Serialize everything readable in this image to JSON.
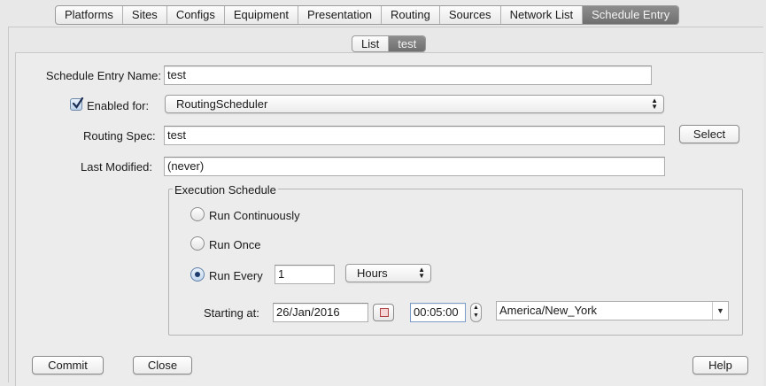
{
  "tabs": [
    {
      "label": "Platforms",
      "active": false
    },
    {
      "label": "Sites",
      "active": false
    },
    {
      "label": "Configs",
      "active": false
    },
    {
      "label": "Equipment",
      "active": false
    },
    {
      "label": "Presentation",
      "active": false
    },
    {
      "label": "Routing",
      "active": false
    },
    {
      "label": "Sources",
      "active": false
    },
    {
      "label": "Network List",
      "active": false
    },
    {
      "label": "Schedule Entry",
      "active": true
    }
  ],
  "subtabs": [
    {
      "label": "List",
      "active": false
    },
    {
      "label": "test",
      "active": true
    }
  ],
  "form": {
    "name_label": "Schedule Entry Name:",
    "name_value": "test",
    "enabled_checked": true,
    "enabled_label": "Enabled for:",
    "enabled_for_value": "RoutingScheduler",
    "routing_spec_label": "Routing Spec:",
    "routing_spec_value": "test",
    "select_button": "Select",
    "last_modified_label": "Last Modified:",
    "last_modified_value": "(never)"
  },
  "schedule": {
    "title": "Execution Schedule",
    "run_continuously": "Run Continuously",
    "run_once": "Run Once",
    "run_every": "Run Every",
    "selected": "run_every",
    "interval_value": "1",
    "interval_unit": "Hours",
    "starting_label": "Starting at:",
    "start_date": "26/Jan/2016",
    "start_time": "00:05:00",
    "timezone": "America/New_York"
  },
  "buttons": {
    "commit": "Commit",
    "close": "Close",
    "help": "Help"
  },
  "colors": {
    "accent": "#1d3c6b",
    "active_tab": "#7a7a7a"
  }
}
